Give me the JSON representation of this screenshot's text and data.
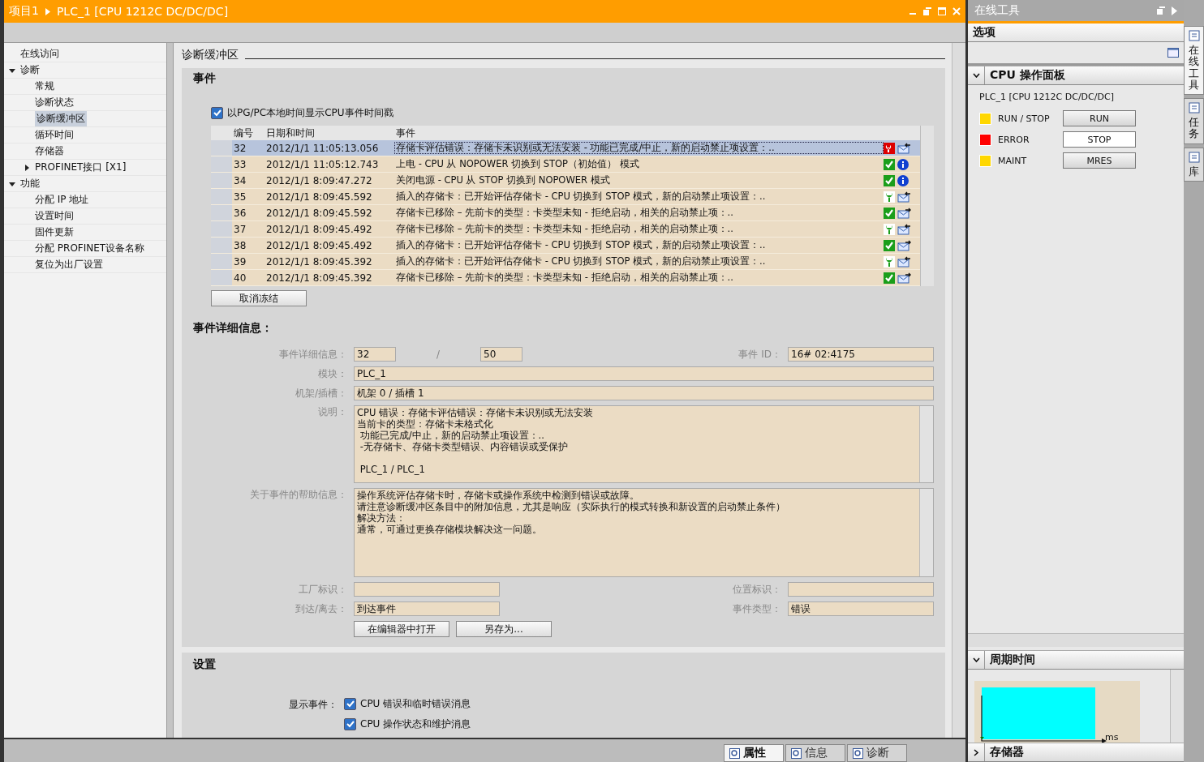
{
  "title_bar": {
    "project": "项目1",
    "device": "PLC_1 [CPU 1212C DC/DC/DC]"
  },
  "nav": [
    {
      "label": "在线访问",
      "selected": false
    },
    {
      "label": "诊断",
      "selected": false,
      "expanded": true,
      "children": [
        {
          "label": "常规",
          "selected": false
        },
        {
          "label": "诊断状态",
          "selected": false
        },
        {
          "label": "诊断缓冲区",
          "selected": true
        },
        {
          "label": "循环时间",
          "selected": false
        },
        {
          "label": "存储器",
          "selected": false
        },
        {
          "label": "PROFINET接口 [X1]",
          "selected": false,
          "expanded": false
        }
      ]
    },
    {
      "label": "功能",
      "selected": false,
      "expanded": true,
      "children": [
        {
          "label": "分配 IP 地址",
          "selected": false
        },
        {
          "label": "设置时间",
          "selected": false
        },
        {
          "label": "固件更新",
          "selected": false
        },
        {
          "label": "分配 PROFINET设备名称",
          "selected": false
        },
        {
          "label": "复位为出厂设置",
          "selected": false
        }
      ]
    }
  ],
  "heading": "诊断缓冲区",
  "events": {
    "title": "事件",
    "local_time": {
      "label": "以PG/PC本地时间显示CPU事件时间戳",
      "checked": true
    },
    "columns": [
      "编号",
      "日期和时间",
      "事件"
    ],
    "rows": [
      {
        "number": "32",
        "datetime": "2012/1/1 11:05:13.056",
        "event": "存储卡评估错误：存储卡未识别或无法安装 - 功能已完成/中止，新的启动禁止项设置：..",
        "icons": [
          {
            "kind": "error"
          },
          {
            "kind": "incoming"
          }
        ],
        "selected": true
      },
      {
        "number": "33",
        "datetime": "2012/1/1 11:05:12.743",
        "event": "上电 - CPU 从 NOPOWER 切换到 STOP（初始值） 模式",
        "icons": [
          {
            "kind": "ok"
          },
          {
            "kind": "info"
          }
        ],
        "selected": false
      },
      {
        "number": "34",
        "datetime": "2012/1/1 8:09:47.272",
        "event": "关闭电源 - CPU 从 STOP 切换到 NOPOWER 模式",
        "icons": [
          {
            "kind": "ok"
          },
          {
            "kind": "info"
          }
        ],
        "selected": false
      },
      {
        "number": "35",
        "datetime": "2012/1/1 8:09:45.592",
        "event": "插入的存储卡：已开始评估存储卡 - CPU 切换到 STOP 模式，新的启动禁止项设置：..",
        "icons": [
          {
            "kind": "maint"
          },
          {
            "kind": "incoming"
          }
        ],
        "selected": false
      },
      {
        "number": "36",
        "datetime": "2012/1/1 8:09:45.592",
        "event": "存储卡已移除 – 先前卡的类型：卡类型未知 - 拒绝启动，相关的启动禁止项：..",
        "icons": [
          {
            "kind": "ok"
          },
          {
            "kind": "outgoing"
          }
        ],
        "selected": false
      },
      {
        "number": "37",
        "datetime": "2012/1/1 8:09:45.492",
        "event": "存储卡已移除 – 先前卡的类型：卡类型未知 - 拒绝启动，相关的启动禁止项：..",
        "icons": [
          {
            "kind": "maint"
          },
          {
            "kind": "incoming"
          }
        ],
        "selected": false
      },
      {
        "number": "38",
        "datetime": "2012/1/1 8:09:45.492",
        "event": "插入的存储卡：已开始评估存储卡 - CPU 切换到 STOP 模式，新的启动禁止项设置：..",
        "icons": [
          {
            "kind": "ok"
          },
          {
            "kind": "outgoing"
          }
        ],
        "selected": false
      },
      {
        "number": "39",
        "datetime": "2012/1/1 8:09:45.392",
        "event": "插入的存储卡：已开始评估存储卡 - CPU 切换到 STOP 模式，新的启动禁止项设置：..",
        "icons": [
          {
            "kind": "maint"
          },
          {
            "kind": "incoming"
          }
        ],
        "selected": false
      },
      {
        "number": "40",
        "datetime": "2012/1/1 8:09:45.392",
        "event": "存储卡已移除 – 先前卡的类型：卡类型未知 - 拒绝启动，相关的启动禁止项：..",
        "icons": [
          {
            "kind": "ok"
          },
          {
            "kind": "outgoing"
          }
        ],
        "selected": false
      }
    ],
    "freeze_button": "取消冻结"
  },
  "details": {
    "title": "事件详细信息：",
    "entry_label": "事件详细信息：",
    "entry_number": "32",
    "entry_separator": "/",
    "entry_total": "50",
    "event_id_label": "事件 ID：",
    "event_id": "16# 02:4175",
    "module_label": "模块：",
    "module": "PLC_1",
    "rack_label": "机架/插槽：",
    "rack": "机架 0 / 插槽 1",
    "description_label": "说明：",
    "description": [
      "CPU 错误：存储卡评估错误：存储卡未识别或无法安装",
      "当前卡的类型：存储卡未格式化",
      " 功能已完成/中止，新的启动禁止项设置：..",
      " -无存储卡、存储卡类型错误、内容错误或受保护",
      " PLC_1 / PLC_1"
    ],
    "help_label": "关于事件的帮助信息：",
    "help": [
      "操作系统评估存储卡时，存储卡或操作系统中检测到错误或故障。",
      "请注意诊断缓冲区条目中的附加信息，尤其是响应（实际执行的模式转换和新设置的启动禁止条件）",
      "解决方法：",
      "通常，可通过更换存储模块解决这一问题。"
    ],
    "plant_label": "工厂标识：",
    "location_label": "位置标识：",
    "arrival_label": "到达/离去：",
    "arrival": "到达事件",
    "type_label": "事件类型：",
    "type": "错误",
    "buttons": [
      "在编辑器中打开",
      "另存为..."
    ]
  },
  "settings": {
    "title": "设置",
    "label": "显示事件：",
    "options": [
      {
        "label": "CPU 错误和临时错误消息",
        "checked": true
      },
      {
        "label": "CPU 操作状态和维护消息",
        "checked": true
      }
    ]
  },
  "right_panel": {
    "title": "在线工具",
    "options_title": "选项",
    "cpu_panel": {
      "title": "CPU 操作面板",
      "expanded": true,
      "device": "PLC_1 [CPU 1212C DC/DC/DC]",
      "rows": [
        {
          "led": "RUN / STOP",
          "color": "#ffd700",
          "button": "RUN",
          "selected": false
        },
        {
          "led": "ERROR",
          "color": "#ff0000",
          "button": "STOP",
          "selected": true
        },
        {
          "led": "MAINT",
          "color": "#ffd700",
          "button": "MRES",
          "selected": false
        }
      ]
    },
    "cycle_time": {
      "title": "周期时间",
      "expanded": true,
      "unit": "ms"
    },
    "memory": {
      "title": "存储器",
      "expanded": false
    }
  },
  "side_tabs": [
    {
      "label": "在线工具",
      "selected": true
    },
    {
      "label": "任务",
      "selected": false
    },
    {
      "label": "库",
      "selected": false
    }
  ],
  "bottom_tabs": [
    {
      "label": "属性",
      "selected": true
    },
    {
      "label": "信息",
      "selected": false
    },
    {
      "label": "诊断",
      "selected": false
    }
  ]
}
